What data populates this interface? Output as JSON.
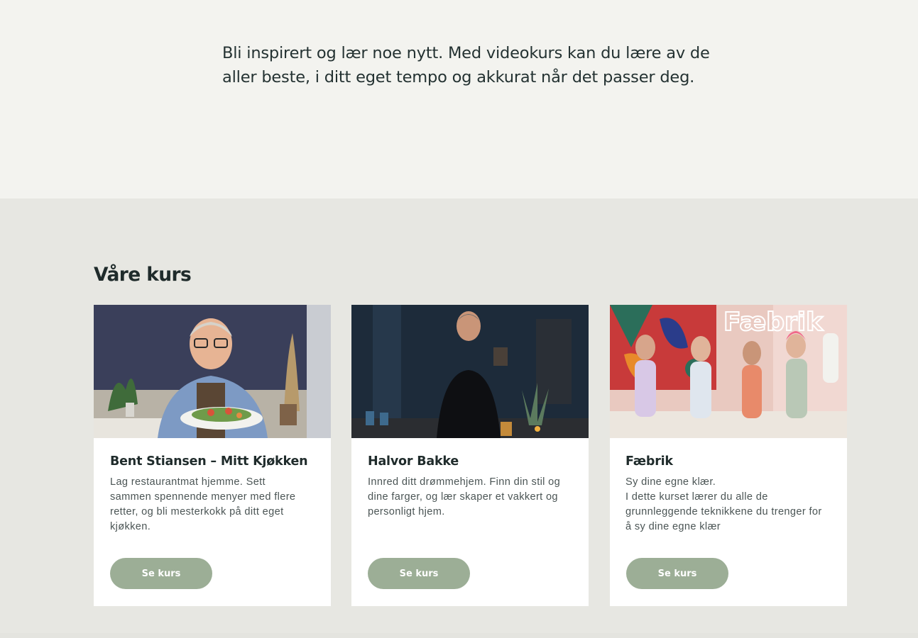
{
  "hero": {
    "intro_line1": "Bli inspirert og lær noe nytt. Med videokurs kan du lære av de",
    "intro_line2": "aller beste, i ditt eget tempo og akkurat når det passer deg."
  },
  "courses_section": {
    "title": "Våre kurs",
    "cards": [
      {
        "title": "Bent Stiansen – Mitt Kjøkken",
        "description_lines": [
          "Lag restaurantmat hjemme. Sett",
          "sammen spennende menyer med flere",
          "retter, og bli mesterkokk på ditt eget",
          "kjøkken."
        ],
        "button_label": "Se kurs",
        "image": "chef-holding-salad-photo"
      },
      {
        "title": "Halvor Bakke",
        "description_lines": [
          "Innred ditt drømmehjem. Finn din stil og",
          "dine farger, og lær skaper et vakkert og",
          "personligt hjem."
        ],
        "button_label": "Se kurs",
        "image": "interior-designer-photo"
      },
      {
        "title": "Fæbrik",
        "description_lines": [
          "Sy dine egne klær.",
          "I dette kurset lærer du alle de",
          "grunnleggende teknikkene du trenger for",
          "å sy dine egne klær"
        ],
        "button_label": "Se kurs",
        "image": "sewing-studio-group-photo",
        "image_sign_text": "Fæbrik"
      }
    ]
  },
  "colors": {
    "hero_bg": "#f3f3ef",
    "section_bg": "#e7e7e2",
    "card_bg": "#ffffff",
    "button_bg": "#9cae96",
    "text": "#1f2b2b"
  }
}
